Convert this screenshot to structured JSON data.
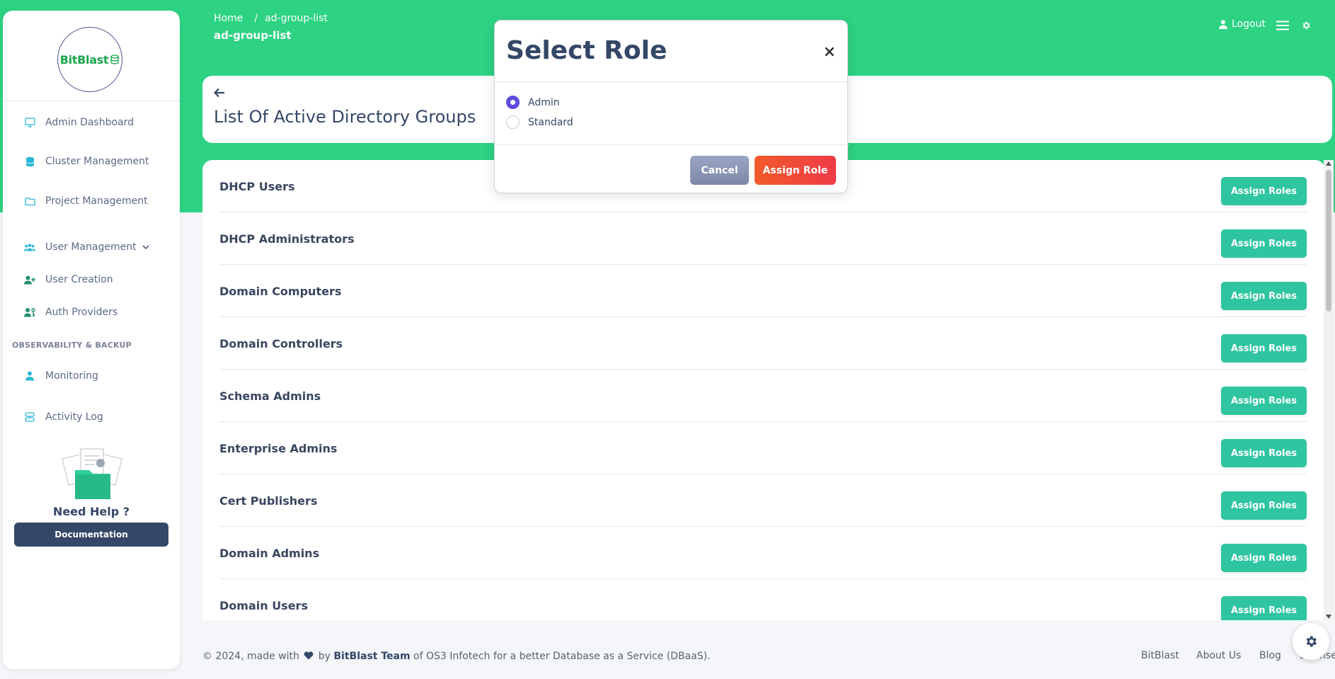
{
  "brand": {
    "logo_text": "BitBlast"
  },
  "sidebar": {
    "items": [
      {
        "label": "Admin Dashboard",
        "icon": "monitor-icon"
      },
      {
        "label": "Cluster Management",
        "icon": "database-icon"
      },
      {
        "label": "Project Management",
        "icon": "folder-icon"
      },
      {
        "label": "User Management",
        "icon": "users-icon"
      },
      {
        "label": "User Creation",
        "icon": "user-plus-icon"
      },
      {
        "label": "Auth Providers",
        "icon": "user-key-icon"
      },
      {
        "label": "Monitoring",
        "icon": "user-icon"
      },
      {
        "label": "Activity Log",
        "icon": "activity-icon"
      }
    ],
    "section_label": "OBSERVABILITY & BACKUP",
    "help_title": "Need Help ?",
    "doc_button": "Documentation"
  },
  "header": {
    "breadcrumb_home": "Home",
    "breadcrumb_sep": "/",
    "breadcrumb_current": "ad-group-list",
    "page_name": "ad-group-list",
    "logout_label": "Logout"
  },
  "main": {
    "title": "List Of Active Directory Groups",
    "groups": [
      {
        "name": "DHCP Users",
        "button": "Assign Roles"
      },
      {
        "name": "DHCP Administrators",
        "button": "Assign Roles"
      },
      {
        "name": "Domain Computers",
        "button": "Assign Roles"
      },
      {
        "name": "Domain Controllers",
        "button": "Assign Roles"
      },
      {
        "name": "Schema Admins",
        "button": "Assign Roles"
      },
      {
        "name": "Enterprise Admins",
        "button": "Assign Roles"
      },
      {
        "name": "Cert Publishers",
        "button": "Assign Roles"
      },
      {
        "name": "Domain Admins",
        "button": "Assign Roles"
      },
      {
        "name": "Domain Users",
        "button": "Assign Roles"
      }
    ]
  },
  "modal": {
    "title": "Select Role",
    "close": "×",
    "options": [
      {
        "label": "Admin",
        "selected": true
      },
      {
        "label": "Standard",
        "selected": false
      }
    ],
    "cancel": "Cancel",
    "assign": "Assign Role"
  },
  "footer": {
    "prefix": "© 2024, made with",
    "by": "by",
    "team": "BitBlast Team",
    "suffix": "of OS3 Infotech for a better Database as a Service (DBaaS).",
    "links": [
      "BitBlast",
      "About Us",
      "Blog",
      "License"
    ]
  },
  "colors": {
    "accent_green": "#2dd283",
    "button_teal": "#2ec5a0",
    "assign_red": "#ef3b47",
    "radio_purple": "#5e4ddb",
    "navy": "#344767"
  }
}
